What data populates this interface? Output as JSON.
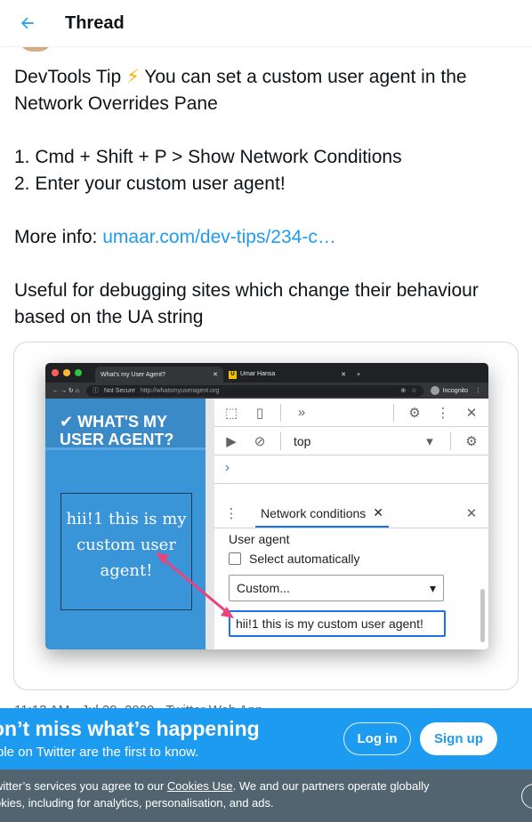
{
  "header": {
    "title": "Thread",
    "back_icon": "arrow-left-icon"
  },
  "tweet": {
    "line1": "DevTools Tip",
    "emoji": "⚡",
    "line1_rest": " You can set a custom user agent in the Network Overrides Pane",
    "step1": "1. Cmd + Shift + P > Show Network Conditions",
    "step2": "2. Enter your custom user agent!",
    "more_info_label": "More info: ",
    "more_info_link": "umaar.com/dev-tips/234-c…",
    "closing": "Useful for debugging sites which change their behaviour based on the UA string"
  },
  "screenshot": {
    "tab1": "What's my User Agent?",
    "tab2": "Umar Hansa",
    "tab2_badge": "U",
    "not_secure": "Not Secure",
    "url": "http://whatsmyuseragent.org",
    "incognito": "Incognito",
    "site_title_line1": "✔ WHAT'S MY",
    "site_title_line2": "USER AGENT?",
    "ua_display": "hii!1 this is my custom user agent!",
    "context": "top",
    "drawer_tab": "Network conditions",
    "user_agent_label": "User agent",
    "select_auto_label": "Select automatically",
    "select_value": "Custom...",
    "ua_input_value": "hii!1 this is my custom user agent!",
    "arrow_color": "#e8457e"
  },
  "timestamp": "11:13 AM · Jul 29, 2020 · Twitter Web App",
  "signup_bar": {
    "title": "on’t miss what’s happening",
    "subtitle": "ple on Twitter are the first to know.",
    "login_label": "Log in",
    "signup_label": "Sign up"
  },
  "cookie_bar": {
    "text_before": "witter’s services you agree to our ",
    "link": "Cookies Use",
    "text_after": ". We and our partners operate globally",
    "line2": "okies, including for analytics, personalisation, and ads."
  },
  "colors": {
    "accent": "#1d9bf0",
    "cookie_bg": "#536471"
  }
}
